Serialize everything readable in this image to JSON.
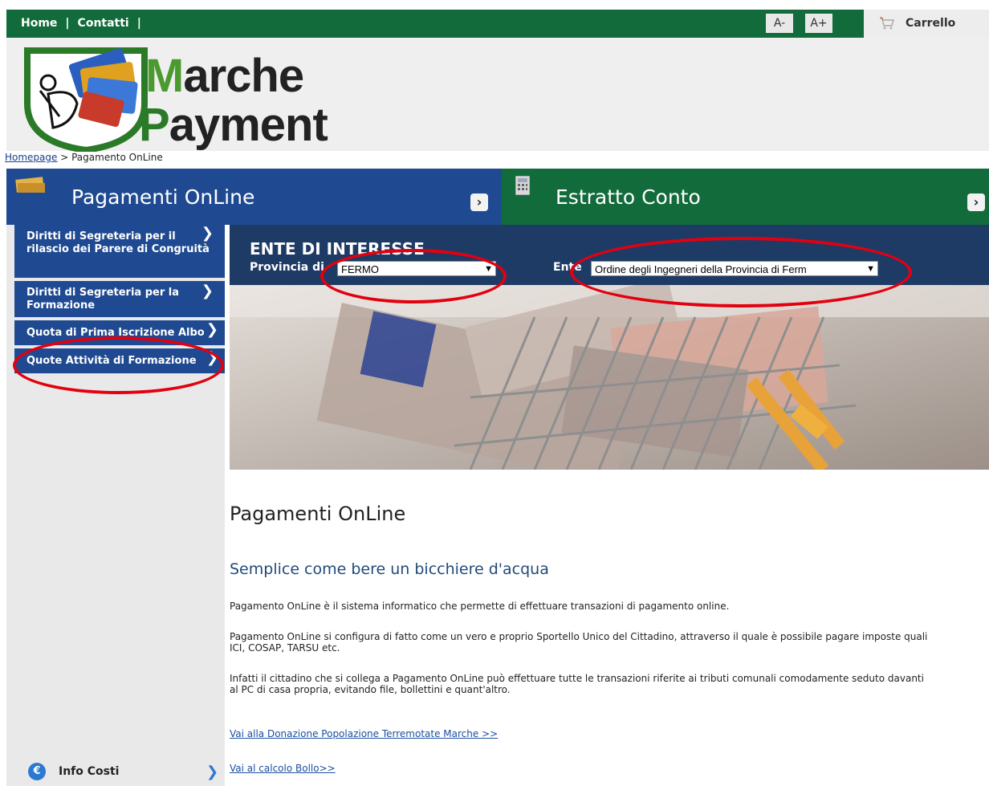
{
  "topbar": {
    "home": "Home",
    "contacts": "Contatti",
    "font_decrease": "A-",
    "font_increase": "A+",
    "cart": "Carrello"
  },
  "logo": {
    "line1_initial": "M",
    "line1_rest": "arche",
    "line2_initial": "P",
    "line2_rest": "ayment"
  },
  "breadcrumb": {
    "home": "Homepage",
    "separator": " > ",
    "current": "Pagamento OnLine"
  },
  "tabs": {
    "payments": "Pagamenti OnLine",
    "statement": "Estratto Conto"
  },
  "sidebar": {
    "items": [
      {
        "label_line1": "Diritti di Segreteria per il",
        "label_line2": "rilascio dei Parere di Congruità"
      },
      {
        "label_line1": "Diritti di Segreteria per la",
        "label_line2": "Formazione"
      },
      {
        "label_line1": "Quota di Prima Iscrizione Albo",
        "label_line2": ""
      },
      {
        "label_line1": "Quote Attività di Formazione",
        "label_line2": ""
      }
    ],
    "footer_label": "Info Costi"
  },
  "ente": {
    "title": "ENTE DI INTERESSE",
    "province_label": "Provincia di",
    "province_value": "FERMO",
    "ente_label": "Ente",
    "ente_value": "Ordine degli Ingegneri della Provincia di Ferm"
  },
  "content": {
    "title": "Pagamenti OnLine",
    "subtitle": "Semplice come bere un bicchiere d'acqua",
    "para1": "Pagamento OnLine è il sistema informatico che permette di effettuare transazioni di pagamento online.",
    "para2_line1": "Pagamento OnLine si configura di fatto come un vero e proprio Sportello Unico del Cittadino, attraverso il quale è possibile pagare imposte quali",
    "para2_line2": "ICI, COSAP, TARSU etc.",
    "para3_line1": "Infatti il cittadino che si collega a Pagamento OnLine può effettuare tutte le transazioni riferite ai tributi comunali comodamente seduto davanti",
    "para3_line2": "al PC di casa propria, evitando file, bollettini e quant'altro.",
    "link1": "Vai alla Donazione Popolazione Terremotate Marche >>",
    "link2": "Vai al calcolo Bollo>>"
  },
  "colors": {
    "green": "#126b3a",
    "blue": "#1f4a91",
    "dark_blue": "#1e3b66",
    "annotation_red": "#e3000f"
  }
}
